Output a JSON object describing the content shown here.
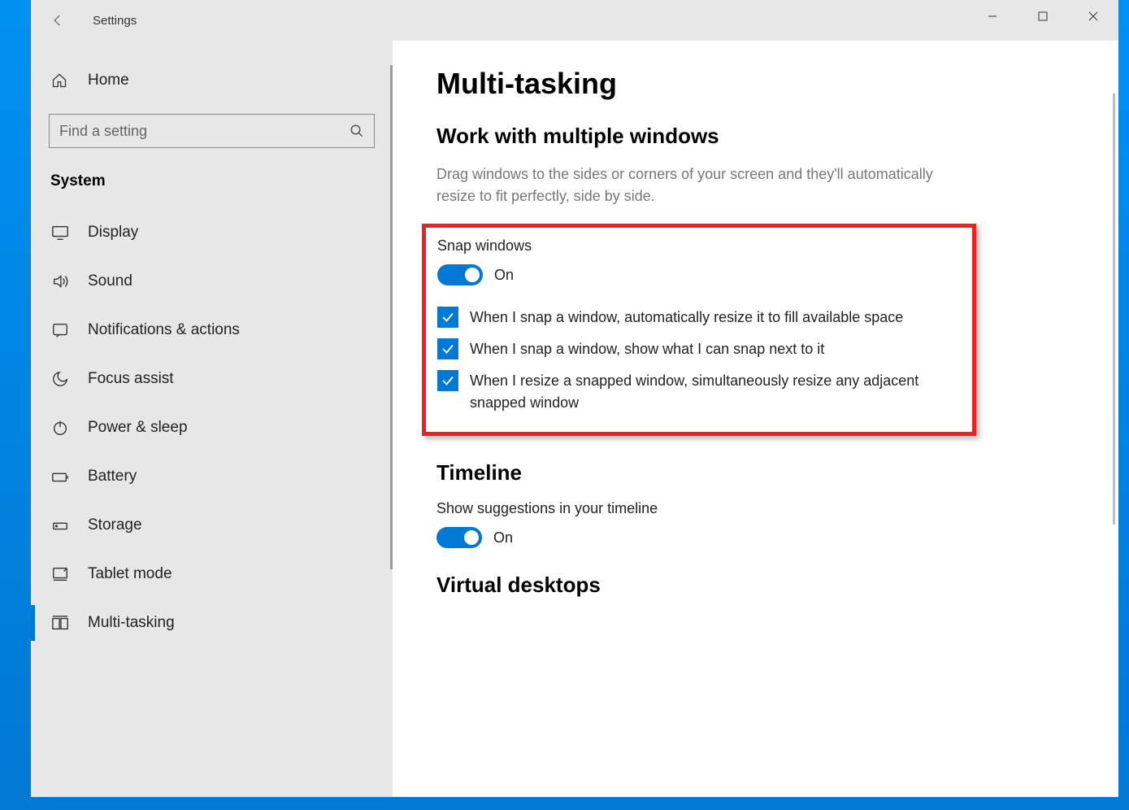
{
  "titlebar": {
    "title": "Settings"
  },
  "sidebar": {
    "home_label": "Home",
    "search_placeholder": "Find a setting",
    "category": "System",
    "items": [
      {
        "label": "Display",
        "icon": "display-icon"
      },
      {
        "label": "Sound",
        "icon": "sound-icon"
      },
      {
        "label": "Notifications & actions",
        "icon": "notifications-icon"
      },
      {
        "label": "Focus assist",
        "icon": "focus-assist-icon"
      },
      {
        "label": "Power & sleep",
        "icon": "power-icon"
      },
      {
        "label": "Battery",
        "icon": "battery-icon"
      },
      {
        "label": "Storage",
        "icon": "storage-icon"
      },
      {
        "label": "Tablet mode",
        "icon": "tablet-icon"
      },
      {
        "label": "Multi-tasking",
        "icon": "multitasking-icon",
        "active": true
      }
    ]
  },
  "main": {
    "page_title": "Multi-tasking",
    "section1": {
      "heading": "Work with multiple windows",
      "desc": "Drag windows to the sides or corners of your screen and they'll automatically resize to fit perfectly, side by side.",
      "snap_label": "Snap windows",
      "snap_state": "On",
      "cb1": "When I snap a window, automatically resize it to fill available space",
      "cb2": "When I snap a window, show what I can snap next to it",
      "cb3": "When I resize a snapped window, simultaneously resize any adjacent snapped window"
    },
    "section2": {
      "heading": "Timeline",
      "tl_label": "Show suggestions in your timeline",
      "tl_state": "On"
    },
    "section3": {
      "heading": "Virtual desktops"
    }
  }
}
